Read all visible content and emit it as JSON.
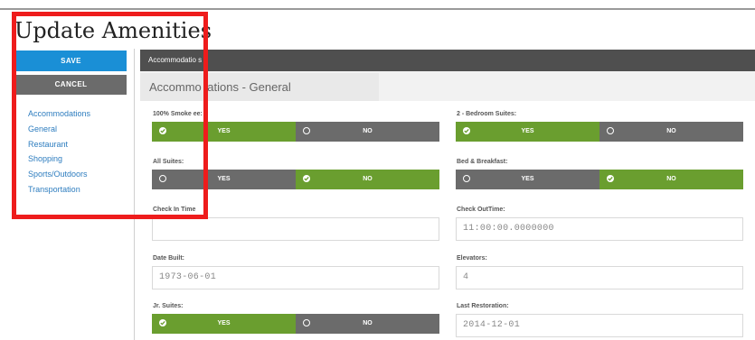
{
  "page": {
    "title": "Update Amenities",
    "corner_mark": "•"
  },
  "actions": {
    "save_label": "SAVE",
    "cancel_label": "CANCEL"
  },
  "sidebar": {
    "items": [
      {
        "label": "Accommodations"
      },
      {
        "label": "General"
      },
      {
        "label": "Restaurant"
      },
      {
        "label": "Shopping"
      },
      {
        "label": "Sports/Outdoors"
      },
      {
        "label": "Transportation"
      }
    ]
  },
  "tab_bar": {
    "label": "Accommodatio s"
  },
  "section": {
    "title": "Accommo    lations - General"
  },
  "toggle_labels": {
    "yes": "YES",
    "no": "NO"
  },
  "fields": {
    "smoke_free": {
      "label": "100% Smoke    ee:",
      "selected": "YES"
    },
    "two_bedroom": {
      "label": "2 - Bedroom Suites:",
      "selected": "YES"
    },
    "all_suites": {
      "label": "All Suites:",
      "selected": "NO"
    },
    "bed_breakfast": {
      "label": "Bed & Breakfast:",
      "selected": "NO"
    },
    "check_in": {
      "label": "Check In Time",
      "value": ""
    },
    "check_out": {
      "label": "Check OutTime:",
      "value": "11:00:00.0000000"
    },
    "date_built": {
      "label": "Date Built:",
      "value": "1973-06-01"
    },
    "elevators": {
      "label": "Elevators:",
      "value": "4"
    },
    "jr_suites": {
      "label": "Jr. Suites:",
      "selected": "YES"
    },
    "last_restoration": {
      "label": "Last Restoration:",
      "value": "2014-12-01"
    }
  },
  "colors": {
    "save_blue": "#1a8fd6",
    "cancel_gray": "#6b6b6b",
    "toggle_on_green": "#6a9e2f",
    "toggle_off_gray": "#6b6b6b",
    "tab_bar": "#4f4f4f",
    "link_blue": "#2e7dbf",
    "highlight_red": "#ee1c1c"
  }
}
